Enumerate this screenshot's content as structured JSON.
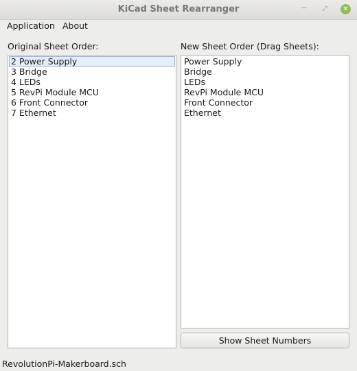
{
  "window": {
    "title": "KiCad Sheet Rearranger",
    "minimize_glyph": "‒",
    "maximize_glyph": "⤢",
    "close_glyph": "✕"
  },
  "menu": {
    "items": [
      "Application",
      "About"
    ]
  },
  "left_panel": {
    "label": "Original Sheet Order:",
    "items": [
      "2 Power Supply",
      "3 Bridge",
      "4 LEDs",
      "5 RevPi Module MCU",
      "6 Front Connector",
      "7 Ethernet"
    ],
    "selected_index": 0
  },
  "right_panel": {
    "label": "New Sheet Order (Drag Sheets):",
    "items": [
      "Power Supply",
      "Bridge",
      "LEDs",
      "RevPi Module MCU",
      "Front Connector",
      "Ethernet"
    ]
  },
  "button": {
    "show_numbers_label": "Show Sheet Numbers"
  },
  "status": {
    "filename": "RevolutionPi-Makerboard.sch"
  },
  "colors": {
    "selection_bg": "#e4eef8",
    "selection_border": "#93b4d6",
    "close_button": "#8fbf57"
  }
}
